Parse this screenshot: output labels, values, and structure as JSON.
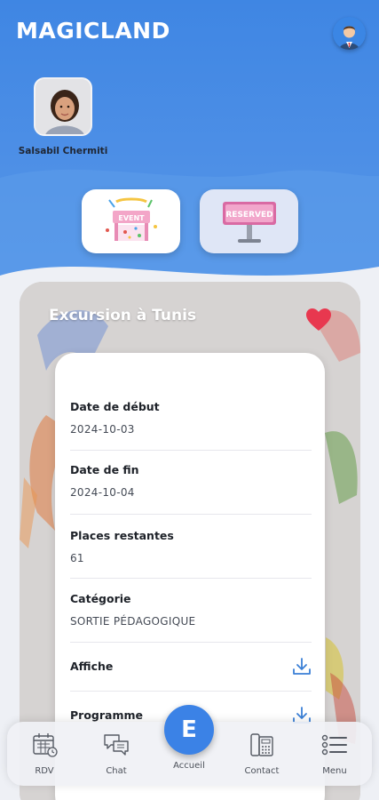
{
  "header": {
    "app_title": "MAGICLAND",
    "child_name": "Salsabil Chermiti"
  },
  "quick_actions": [
    {
      "icon": "event-sign-icon",
      "label": "EVENT"
    },
    {
      "icon": "reserved-sign-icon",
      "label": "RESERVED"
    }
  ],
  "event": {
    "title": "Excursion à Tunis",
    "favorite": true,
    "fields": {
      "start_label": "Date de début",
      "start_value": "2024-10-03",
      "end_label": "Date de fin",
      "end_value": "2024-10-04",
      "places_label": "Places restantes",
      "places_value": "61",
      "category_label": "Catégorie",
      "category_value": "SORTIE PÉDAGOGIQUE",
      "poster_label": "Affiche",
      "program_label": "Programme"
    }
  },
  "nav": {
    "rdv": "RDV",
    "chat": "Chat",
    "home": "Accueil",
    "home_letter": "E",
    "contact": "Contact",
    "menu": "Menu"
  },
  "colors": {
    "primary": "#3f86e3",
    "heart": "#e8384f",
    "download": "#3a7fd6"
  }
}
